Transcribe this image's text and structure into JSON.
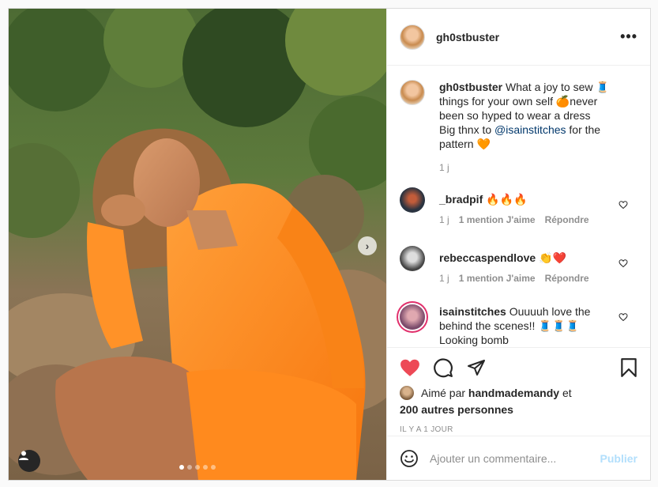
{
  "post": {
    "author": "gh0stbuster",
    "caption": {
      "username": "gh0stbuster",
      "line1": "What a joy to sew 🧵",
      "line2": "things for your own self 🍊never",
      "line3": "been so hyped to wear a dress",
      "line4": "Big thnx to",
      "mention": "@isainstitches",
      "line4_tail": "for the",
      "line5": "pattern 🧡",
      "time": "1 j"
    },
    "more_label": "•••",
    "next_label": "›"
  },
  "comments": [
    {
      "username": "_bradpif",
      "text": "🔥🔥🔥",
      "time": "1 j",
      "likes": "1 mention J'aime",
      "reply": "Répondre"
    },
    {
      "username": "rebeccaspendlove",
      "text": "👏❤️",
      "time": "1 j",
      "likes": "1 mention J'aime",
      "reply": "Répondre"
    },
    {
      "username": "isainstitches",
      "text": "Ouuuuh love the",
      "text2": "behind the scenes!! 🧵🧵🧵",
      "text3": "Looking bomb"
    }
  ],
  "likes": {
    "prefix": "Aimé par",
    "user": "handmademandy",
    "conj": "et",
    "others": "200 autres personnes"
  },
  "time_ago": "IL Y A 1 JOUR",
  "add_comment": {
    "placeholder": "Ajouter un commentaire...",
    "publish": "Publier"
  },
  "colors": {
    "like_red": "#ed4956",
    "publish_disabled": "#b2dffc",
    "dress_orange": "#ff8a1e"
  },
  "carousel": {
    "count": 5,
    "active": 1
  }
}
